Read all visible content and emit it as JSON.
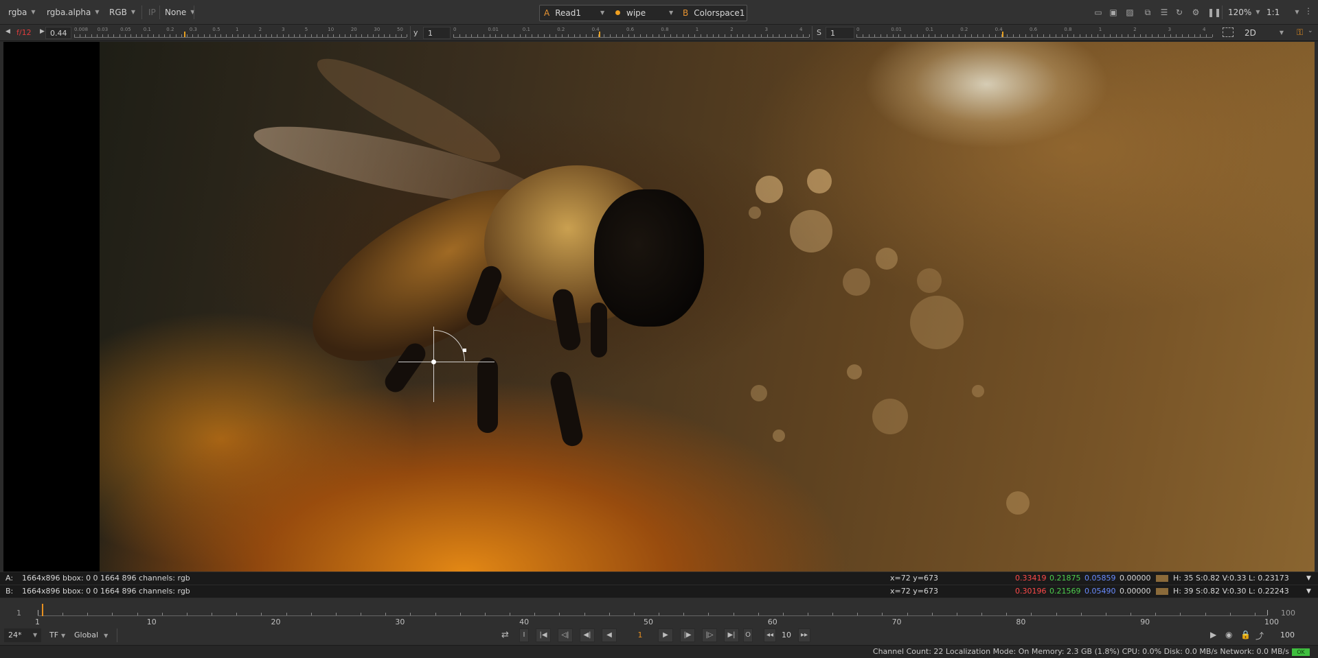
{
  "top_bar": {
    "channels": "rgba",
    "alpha_channel": "rgba.alpha",
    "display_channels": "RGB",
    "ip_label": "IP",
    "lut": "None",
    "input_a_letter": "A",
    "input_a": "Read1",
    "compare_mode": "wipe",
    "input_b_letter": "B",
    "input_b": "Colorspace1",
    "zoom": "120%",
    "proxy": "1:1"
  },
  "second_bar": {
    "fstop": "f/12",
    "gain": "0.44",
    "gamma_label": "y",
    "gamma": "1",
    "saturation_label": "S",
    "saturation": "1",
    "view_mode": "2D",
    "gain_ticks": [
      "0.008",
      "0.03",
      "0.05",
      "0.1",
      "0.2",
      "0.3",
      "0.5",
      "1",
      "2",
      "3",
      "5",
      "10",
      "20",
      "30",
      "50"
    ],
    "gamma_ticks": [
      "0",
      "0.01",
      "0.1",
      "0.2",
      "0.4",
      "0.6",
      "0.8",
      "1",
      "2",
      "3",
      "4"
    ],
    "sat_ticks": [
      "0",
      "0.01",
      "0.1",
      "0.2",
      "0.4",
      "0.6",
      "0.8",
      "1",
      "2",
      "3",
      "4"
    ]
  },
  "info": {
    "a_label": "A:",
    "a_format": "1664x896  bbox: 0 0 1664 896 channels: rgb",
    "a_coords": "x=72 y=673",
    "a_r": "0.33419",
    "a_g": "0.21875",
    "a_b": "0.05859",
    "a_a": "0.00000",
    "a_hsv": "H: 35 S:0.82 V:0.33  L: 0.23173",
    "b_label": "B:",
    "b_format": "1664x896  bbox: 0 0 1664 896 channels: rgb",
    "b_coords": "x=72 y=673",
    "b_r": "0.30196",
    "b_g": "0.21569",
    "b_b": "0.05490",
    "b_a": "0.00000",
    "b_hsv": "H: 39 S:0.82 V:0.30  L: 0.22243"
  },
  "timeline": {
    "start": "1",
    "end": "100",
    "labels": [
      "1",
      "10",
      "20",
      "30",
      "40",
      "50",
      "60",
      "70",
      "80",
      "90",
      "100"
    ]
  },
  "transport": {
    "fps": "24*",
    "time_format": "TF",
    "range": "Global",
    "current_frame": "1",
    "increment": "10",
    "end_frame": "100",
    "in_label": "I",
    "out_label": "O"
  },
  "status": {
    "text": "Channel Count: 22  Localization Mode: On  Memory: 2.3 GB (1.8%)  CPU: 0.0%  Disk: 0.0 MB/s  Network: 0.0 MB/s",
    "ok": "OK"
  }
}
